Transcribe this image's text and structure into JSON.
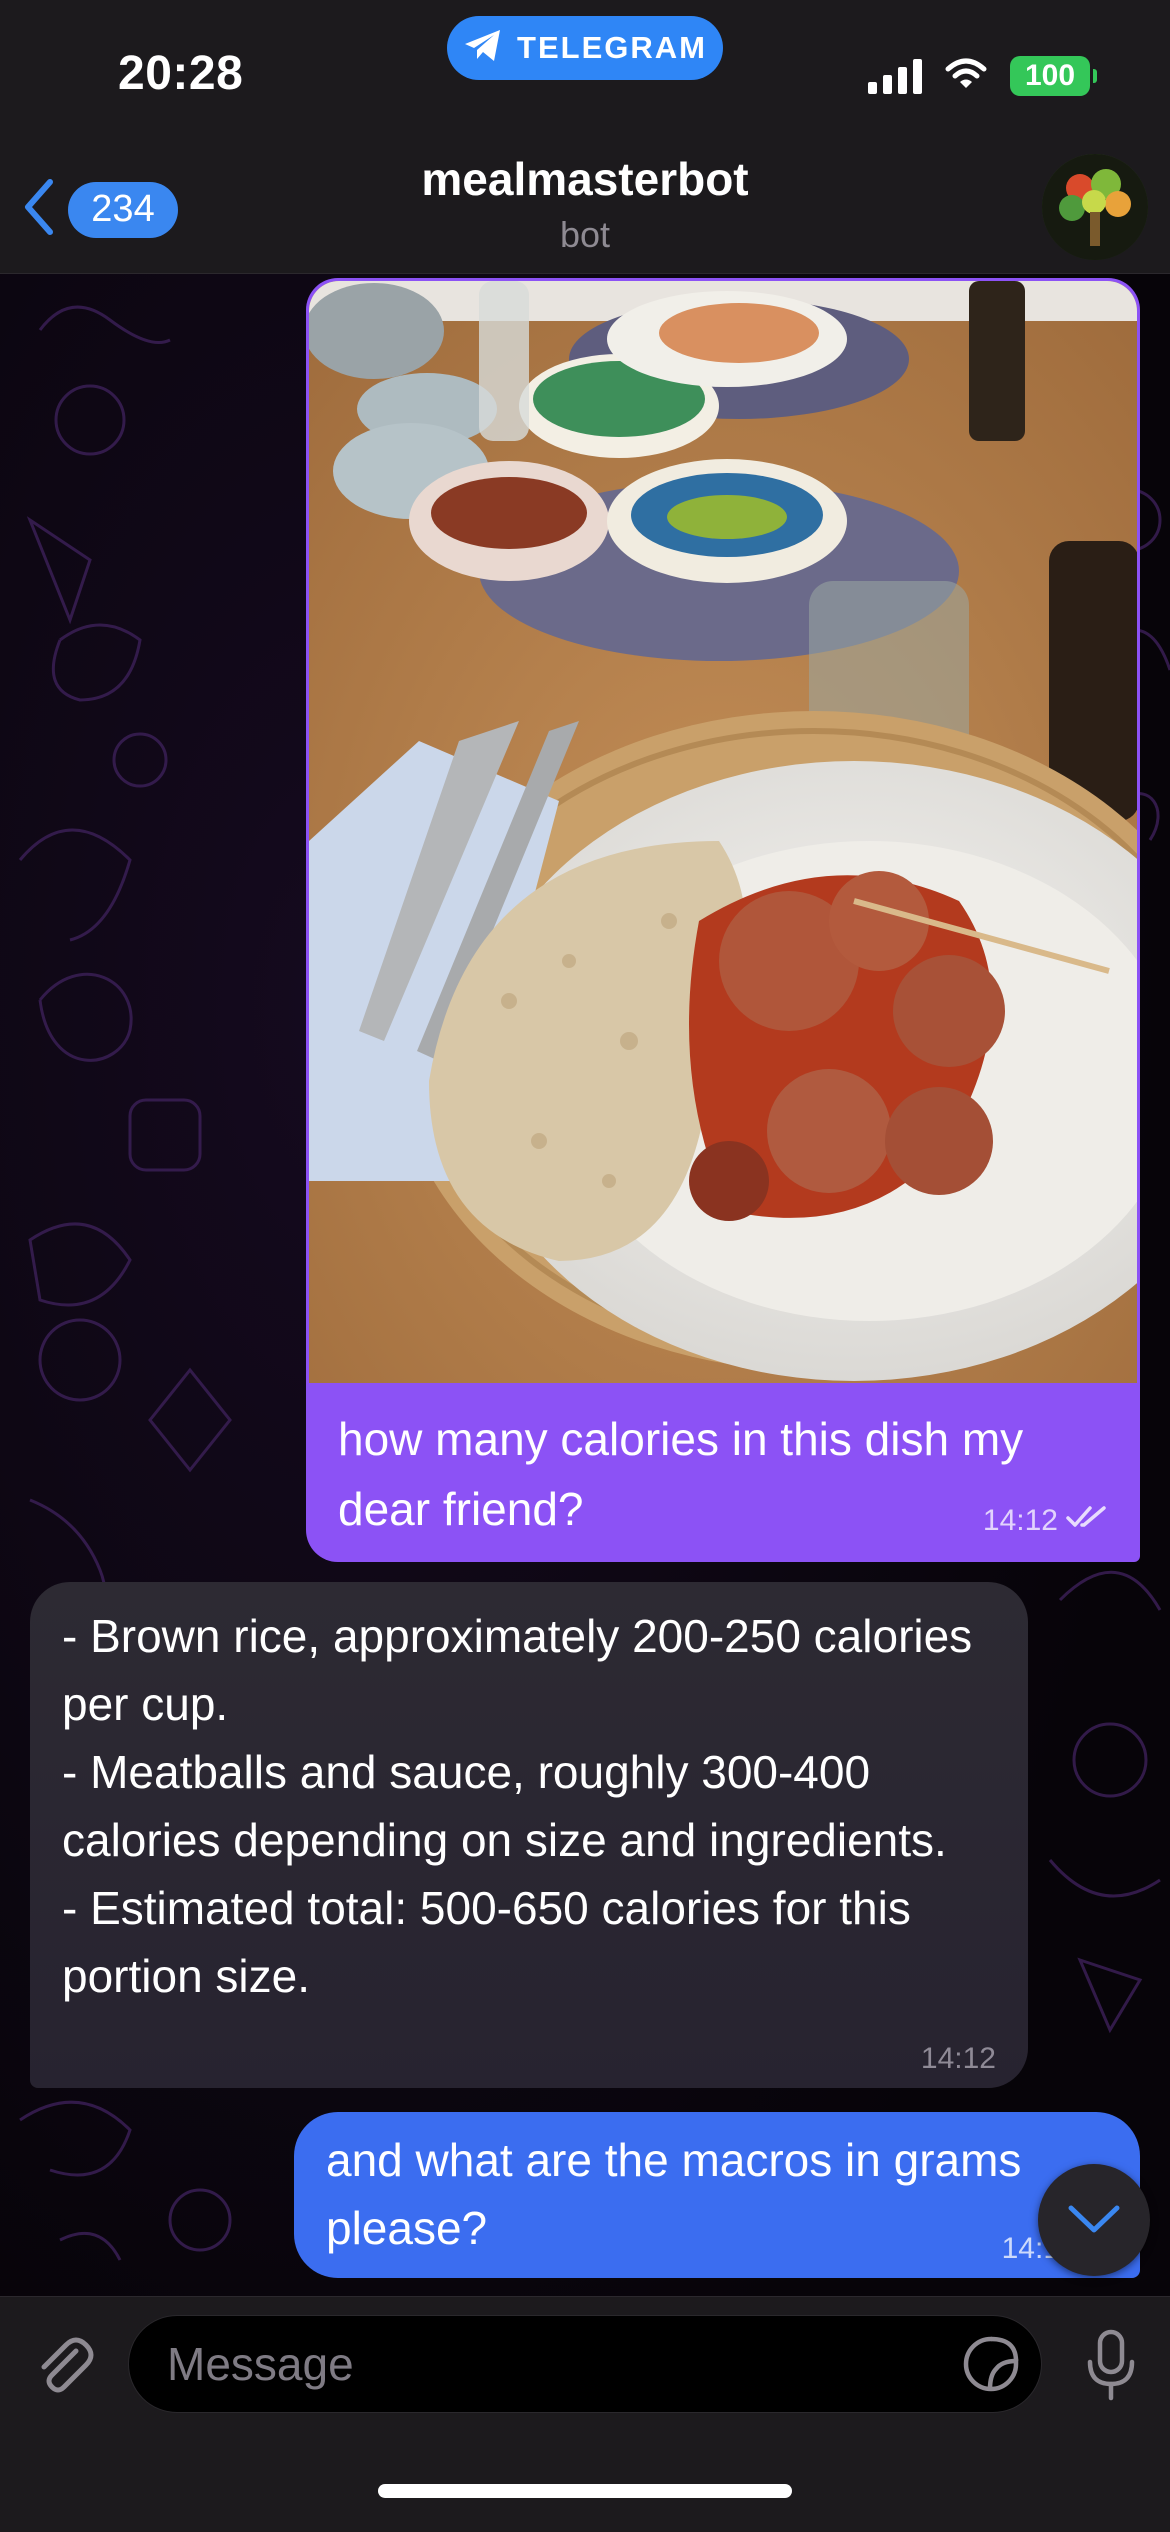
{
  "status_bar": {
    "time": "20:28",
    "app_pill_label": "TELEGRAM",
    "battery": "100"
  },
  "header": {
    "back_count": "234",
    "title": "mealmasterbot",
    "subtitle": "bot"
  },
  "messages": [
    {
      "direction": "outgoing",
      "type": "photo",
      "text": "how many calories in this dish my dear friend?",
      "time": "14:12",
      "status": "read"
    },
    {
      "direction": "incoming",
      "type": "text",
      "text": "- Brown rice, approximately 200-250 calories per cup.\n- Meatballs and sauce, roughly 300-400 calories depending on size and ingredients.\n- Estimated total: 500-650 calories for this portion size.",
      "time": "14:12"
    },
    {
      "direction": "outgoing",
      "type": "text",
      "text": "and what are the macros in grams please?",
      "time": "14:1"
    }
  ],
  "composer": {
    "placeholder": "Message"
  },
  "icons": {
    "back": "chevron-left-icon",
    "scroll": "chevron-down-icon",
    "attach": "paperclip-icon",
    "sticker": "sticker-icon",
    "mic": "microphone-icon",
    "read": "double-check-icon"
  },
  "colors": {
    "accent": "#3a87f0",
    "outgoing_photo_bubble": "#8c52f5",
    "outgoing_text_bubble": "#3b6df0",
    "incoming_bubble": "#2b2831",
    "battery": "#34c759"
  }
}
